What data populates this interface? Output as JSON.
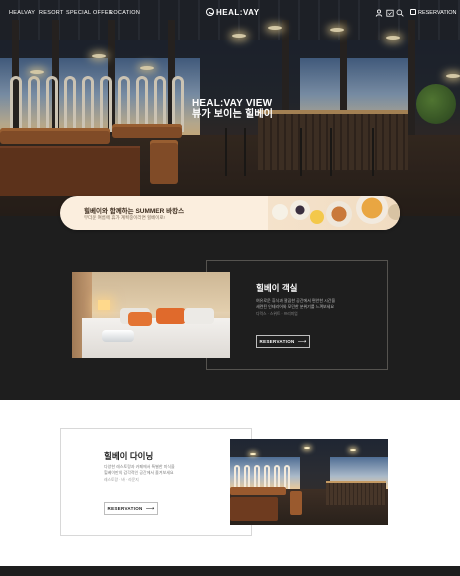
{
  "nav": {
    "links": [
      "HEALVAY",
      "RESORT",
      "SPECIAL OFFER",
      "LOCATION"
    ],
    "logo": "HEAL:VAY",
    "reservation": "RESERVATION",
    "icons": [
      "user-icon",
      "calendar-check-icon",
      "search-icon",
      "calendar-icon"
    ]
  },
  "hero": {
    "title_line1": "HEAL:VAY VIEW",
    "title_line2": "뷰가 보이는 힐베이"
  },
  "promo": {
    "title": "힐베이와 함께하는 SUMMER 바캉스",
    "subtitle": "무더운 여름에 휴가 계획중이라면 힐베이로!"
  },
  "rooms": {
    "title": "힐베이 객실",
    "desc_line1": "여유로운 휴식과 깔끔한 공간에서 편안한 시간을",
    "desc_line2": "세련된 인테리어와 모던한 분위기를 느껴보세요",
    "tags": "디럭스 · 스위트 · 프리미엄",
    "button": "RESERVATION"
  },
  "dining": {
    "title": "힐베이 다이닝",
    "desc_line1": "다양한 레스토랑과 카페에서 특별한 미식을",
    "desc_line2": "힐베이만의 감각적인 공간에서 즐겨보세요",
    "tags": "레스토랑 · 바 · 라운지",
    "button": "RESERVATION"
  },
  "colors": {
    "dark_bg": "#1e1e1e",
    "promo_bg": "#fbeede",
    "white": "#ffffff"
  }
}
